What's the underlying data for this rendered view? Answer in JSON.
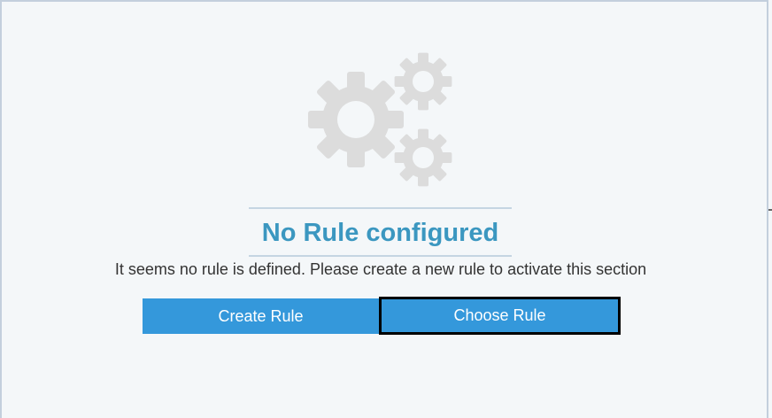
{
  "empty_state": {
    "icon": "gears-icon",
    "title": "No Rule configured",
    "message": "It seems no rule is defined. Please create a new rule to activate this section"
  },
  "actions": {
    "create_label": "Create Rule",
    "choose_label": "Choose Rule"
  },
  "colors": {
    "accent": "#3498db",
    "title": "#3b97c0",
    "icon": "#dcdcdc",
    "background": "#f4f7f9"
  }
}
